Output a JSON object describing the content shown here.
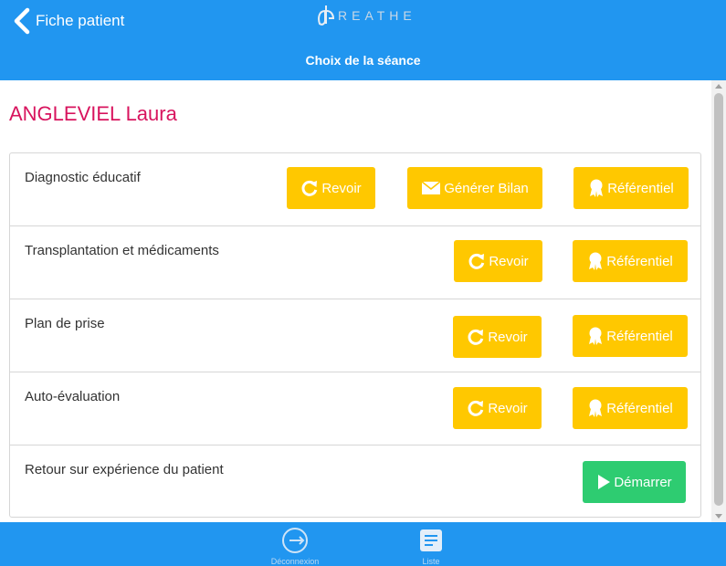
{
  "header": {
    "back_label": "Fiche patient",
    "logo_text": "REATHE",
    "page_title": "Choix de la séance"
  },
  "patient": {
    "name": "ANGLEVIEL Laura"
  },
  "sessions": [
    {
      "label": "Diagnostic éducatif",
      "buttons": [
        {
          "label": "Revoir",
          "icon": "refresh-icon"
        },
        {
          "label": "Générer Bilan",
          "icon": "envelope-icon"
        },
        {
          "label": "Référentiel",
          "icon": "award-icon"
        }
      ]
    },
    {
      "label": "Transplantation et médicaments",
      "buttons": [
        {
          "label": "Revoir",
          "icon": "refresh-icon"
        },
        {
          "label": "Référentiel",
          "icon": "award-icon"
        }
      ]
    },
    {
      "label": "Plan de prise",
      "buttons": [
        {
          "label": "Revoir",
          "icon": "refresh-icon"
        },
        {
          "label": "Référentiel",
          "icon": "award-icon"
        }
      ]
    },
    {
      "label": "Auto-évaluation",
      "buttons": [
        {
          "label": "Revoir",
          "icon": "refresh-icon"
        },
        {
          "label": "Référentiel",
          "icon": "award-icon"
        }
      ]
    },
    {
      "label": "Retour sur expérience du patient",
      "buttons": [
        {
          "label": "Démarrer",
          "icon": "play-icon"
        }
      ]
    }
  ],
  "footer": {
    "tabs": [
      {
        "label": "Déconnexion",
        "icon": "logout-icon"
      },
      {
        "label": "Liste",
        "icon": "list-icon"
      }
    ]
  },
  "colors": {
    "primary": "#2196f0",
    "accent_name": "#d8145e",
    "button_yellow": "#ffc800",
    "button_green": "#2ecc71"
  }
}
